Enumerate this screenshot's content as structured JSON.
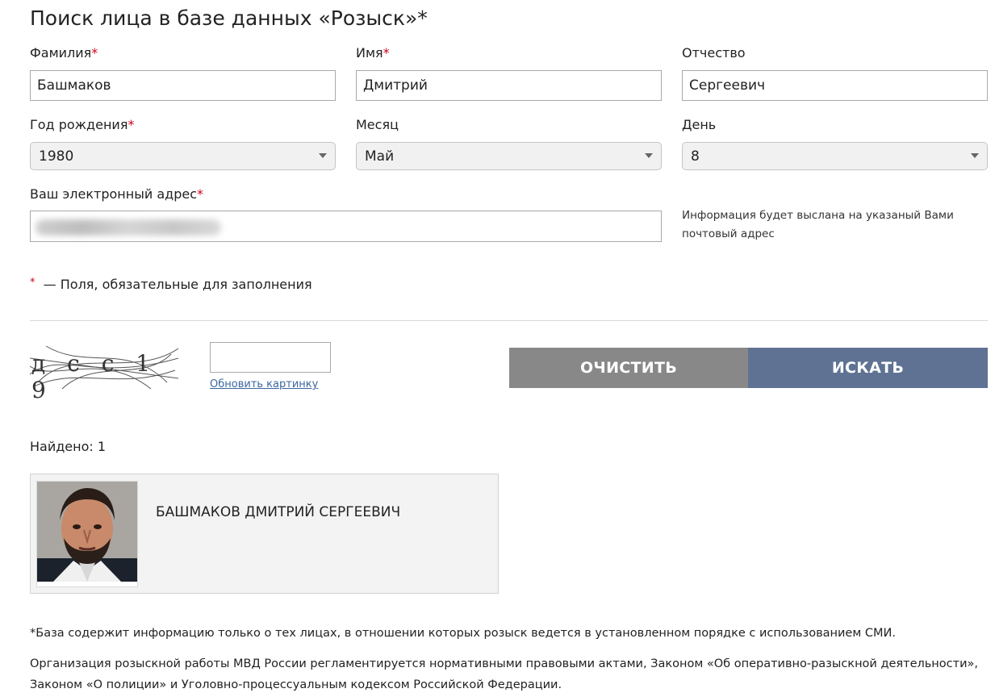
{
  "title": "Поиск лица в базе данных «Розыск»*",
  "fields": {
    "surname": {
      "label": "Фамилия",
      "value": "Башмаков"
    },
    "name": {
      "label": "Имя",
      "value": "Дмитрий"
    },
    "patronymic": {
      "label": "Отчество",
      "value": "Сергеевич"
    },
    "year": {
      "label": "Год рождения",
      "value": "1980"
    },
    "month": {
      "label": "Месяц",
      "value": "Май"
    },
    "day": {
      "label": "День",
      "value": "8"
    },
    "email": {
      "label": "Ваш электронный адрес",
      "value": ""
    }
  },
  "required_mark": "*",
  "email_hint": "Информация будет выслана на указаный Вами почтовый адрес",
  "required_note": "— Поля, обязательные для заполнения",
  "captcha": {
    "text": "д с с 1 9",
    "refresh_label": "Обновить картинку",
    "input_value": ""
  },
  "buttons": {
    "clear": "ОЧИСТИТЬ",
    "search": "ИСКАТЬ"
  },
  "colors": {
    "clear_bg": "#888888",
    "search_bg": "#5f7293",
    "required": "#d0021b"
  },
  "results": {
    "count_label": "Найдено: 1",
    "items": [
      {
        "name": "БАШМАКОВ ДМИТРИЙ СЕРГЕЕВИЧ"
      }
    ]
  },
  "footer": {
    "note1": "*База содержит информацию только о тех лицах, в отношении которых розыск ведется в установленном порядке с использованием СМИ.",
    "note2": "Организация розыскной работы МВД России регламентируется нормативными правовыми актами, Законом «Об оперативно-разыскной деятельности», Законом «О полиции» и Уголовно-процессуальным кодексом Российской Федерации."
  }
}
